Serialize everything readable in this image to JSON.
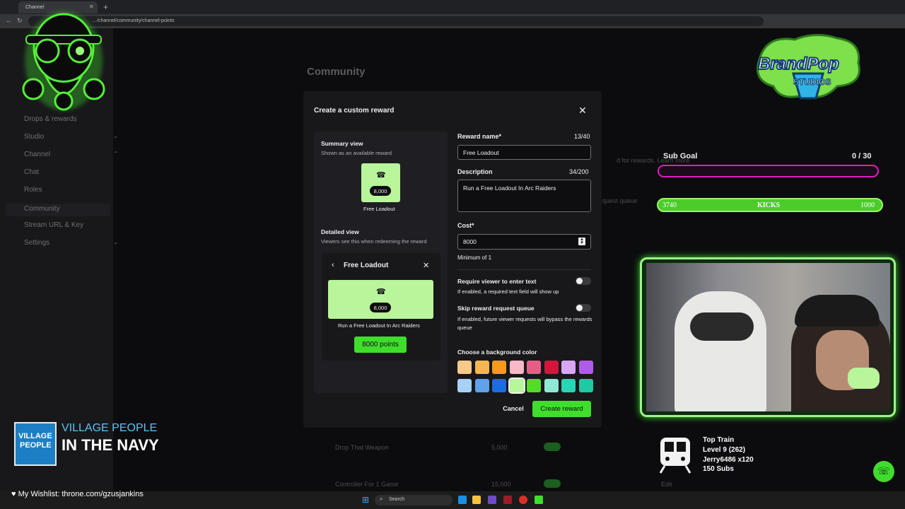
{
  "browser": {
    "tab_title": "Channel",
    "address": "…/channel/community/channel-points"
  },
  "sidebar": {
    "items": [
      {
        "label": "Drops & rewards",
        "chevron": ""
      },
      {
        "label": "Studio",
        "chevron": "⌄"
      },
      {
        "label": "Channel",
        "chevron": "⌃"
      },
      {
        "label": "Chat",
        "chevron": ""
      },
      {
        "label": "Roles",
        "chevron": ""
      },
      {
        "label": "Community",
        "chevron": ""
      },
      {
        "label": "Stream URL & Key",
        "chevron": ""
      },
      {
        "label": "Settings",
        "chevron": "⌄"
      }
    ]
  },
  "page": {
    "title": "Community",
    "bg_rows": [
      {
        "name": "Drop That Weapon",
        "cost": "5,000"
      },
      {
        "name": "Controller For 1 Game",
        "cost": "15,000"
      }
    ],
    "bg_text_1": "d for rewards. Learn more",
    "bg_text_2": "quest queue",
    "edit_label": "Edit"
  },
  "modal": {
    "title": "Create a custom reward",
    "summary_title": "Summary view",
    "summary_sub": "Shown as an available reward",
    "reward_cost": "8,000",
    "reward_name": "Free Loadout",
    "detailed_title": "Detailed view",
    "detailed_sub": "Viewers see this when redeeming the reward",
    "detail_desc": "Run a Free Loadout In Arc Raiders",
    "points_button": "8000 points",
    "name_label": "Reward name*",
    "name_counter": "13/40",
    "name_value": "Free Loadout",
    "desc_label": "Description",
    "desc_counter": "34/200",
    "desc_value": "Run a Free Loadout In Arc Raiders",
    "cost_label": "Cost*",
    "cost_value": "8000",
    "cost_hint": "Minimum of 1",
    "require_text_label": "Require viewer to enter text",
    "require_text_hint": "If enabled, a required text field will show up",
    "skip_queue_label": "Skip reward request queue",
    "skip_queue_hint": "If enabled, future viewer requests will bypass the rewards queue",
    "color_label": "Choose a background color",
    "colors": [
      "#f7c98a",
      "#f4b74e",
      "#f59a1c",
      "#f7b8c8",
      "#e85d86",
      "#d4163c",
      "#d8a6f5",
      "#b15ce8",
      "#a8d1f5",
      "#5fa2ea",
      "#1a6ee0",
      "#b9f59a",
      "#53dd2a",
      "#8ee8d4",
      "#26d6b5",
      "#1fc9a1"
    ],
    "selected_color_index": 11,
    "cancel_label": "Cancel",
    "create_label": "Create reward"
  },
  "overlay": {
    "brand_line1": "BrandPop",
    "brand_line2": "STUDIOS",
    "sub_goal_label": "Sub Goal",
    "sub_goal_value": "0 / 30",
    "sub_goal_progress": 0,
    "kicks_left": "3740",
    "kicks_label": "KICKS",
    "kicks_right": "1000",
    "top_train_title": "Top Train",
    "top_train_level": "Level 9  (262)",
    "top_train_user": "Jerry6486 x120",
    "top_train_subs": "150 Subs",
    "np_art_text_1": "VILLAGE",
    "np_art_text_2": "PEOPLE",
    "np_artist": "VILLAGE PEOPLE",
    "np_song": "IN THE NAVY",
    "wishlist": "My Wishlist: throne.com/gzusjankins"
  },
  "taskbar": {
    "search_placeholder": "Search"
  }
}
